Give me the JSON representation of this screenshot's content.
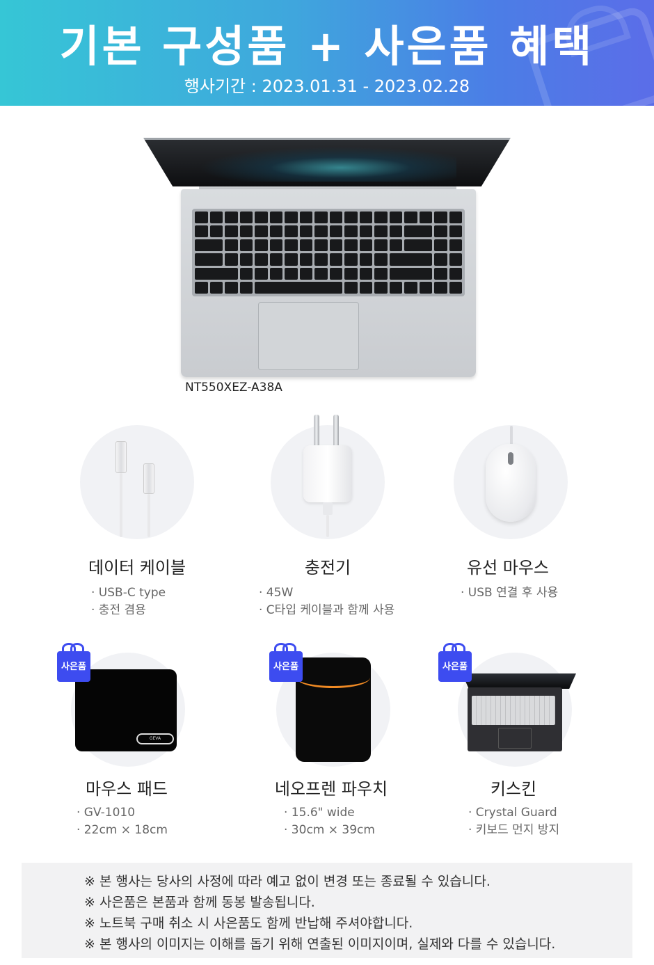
{
  "banner": {
    "title": "기본 구성품 + 사은품 혜택",
    "period": "행사기간 : 2023.01.31 - 2023.02.28"
  },
  "product": {
    "model": "NT550XEZ-A38A"
  },
  "basic_items": [
    {
      "title": "데이터 케이블",
      "specs": [
        "· USB-C type",
        "· 충전 겸용"
      ]
    },
    {
      "title": "충전기",
      "specs": [
        "· 45W",
        "· C타입 케이블과 함께 사용"
      ]
    },
    {
      "title": "유선 마우스",
      "specs": [
        "· USB 연결 후 사용"
      ]
    }
  ],
  "gift_badge": "사은품",
  "gift_items": [
    {
      "title": "마우스 패드",
      "specs": [
        "· GV-1010",
        "· 22cm × 18cm"
      ],
      "logo": "GEVA"
    },
    {
      "title": "네오프렌 파우치",
      "specs": [
        "· 15.6\" wide",
        "· 30cm × 39cm"
      ]
    },
    {
      "title": "키스킨",
      "specs": [
        "· Crystal Guard",
        "· 키보드 먼지 방지"
      ]
    }
  ],
  "notes": [
    "※ 본 행사는 당사의 사정에 따라 예고 없이 변경 또는 종료될 수 있습니다.",
    "※ 사은품은 본품과 함께 동봉 발송됩니다.",
    "※ 노트북 구매 취소 시 사은품도 함께 반납해 주셔야합니다.",
    "※ 본 행사의 이미지는 이해를 돕기 위해 연출된 이미지이며, 실제와 다를 수 있습니다."
  ],
  "colors": {
    "banner_start": "#36c6d6",
    "banner_end": "#5b6de8",
    "gift_badge": "#3d4cf0",
    "pouch_zip": "#f08a24"
  }
}
